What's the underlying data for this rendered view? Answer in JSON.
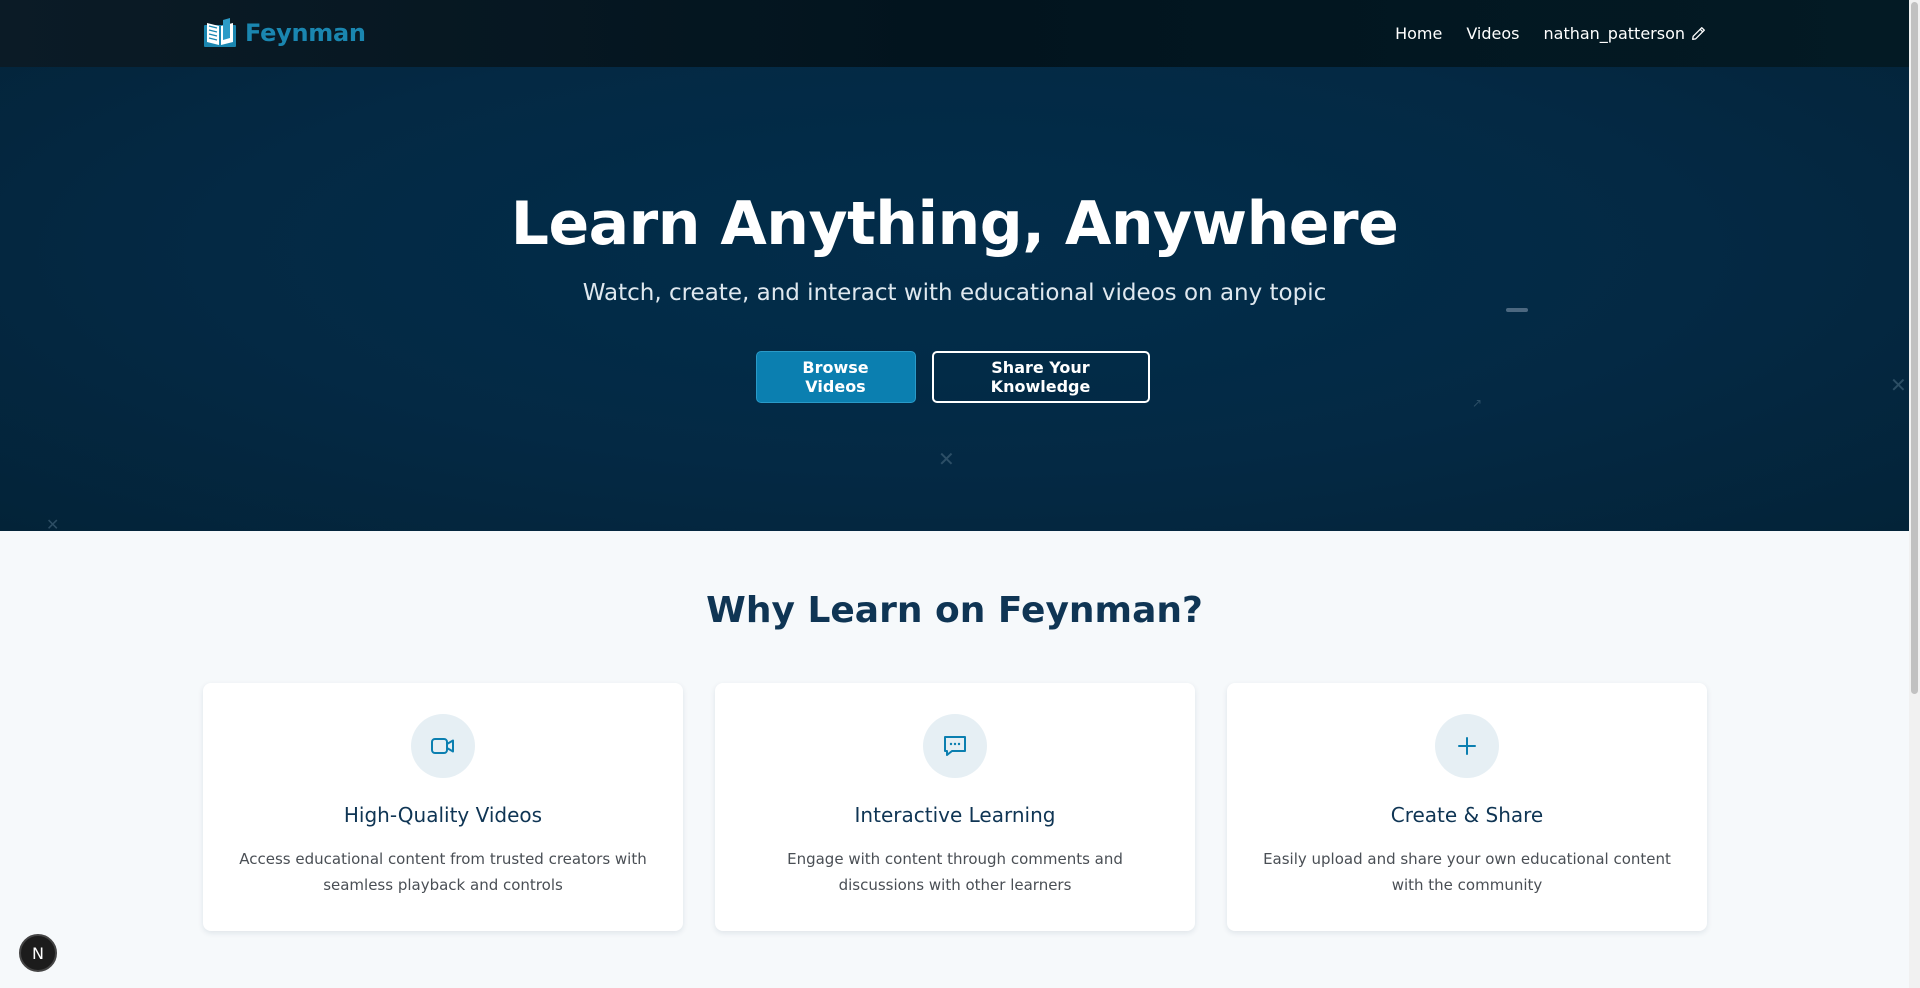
{
  "navbar": {
    "brand": "Feynman",
    "brand_icon": "open-book-icon",
    "links": [
      "Home",
      "Videos"
    ],
    "username": "nathan_patterson",
    "edit_icon": "pencil-icon"
  },
  "hero": {
    "title": "Learn Anything, Anywhere",
    "subtitle": "Watch, create, and interact with educational videos on any topic",
    "primary_button": "Browse Videos",
    "secondary_button": "Share Your Knowledge"
  },
  "features": {
    "title": "Why Learn on Feynman?",
    "cards": [
      {
        "icon": "video-camera-icon",
        "title": "High-Quality Videos",
        "description": "Access educational content from trusted creators with seamless playback and controls"
      },
      {
        "icon": "chat-bubble-icon",
        "title": "Interactive Learning",
        "description": "Engage with content through comments and discussions with other learners"
      },
      {
        "icon": "plus-icon",
        "title": "Create & Share",
        "description": "Easily upload and share your own educational content with the community"
      }
    ]
  },
  "badge": {
    "label": "N"
  },
  "colors": {
    "brand": "#1a86b0",
    "navbar_bg": "#02141e",
    "hero_bg": "#032d4a",
    "primary_button": "#0b7fb0",
    "heading": "#0f3554"
  }
}
